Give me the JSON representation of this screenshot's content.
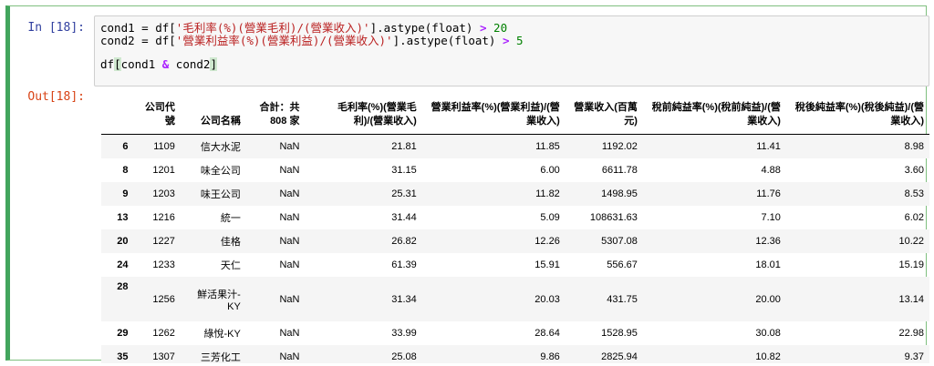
{
  "input": {
    "prompt": "In [18]:",
    "lines": [
      {
        "a": "cond1 = df[",
        "s": "'毛利率(%)(營業毛利)/(營業收入)'",
        "b": "].astype(float) ",
        "op": ">",
        "sp": " ",
        "n": "20"
      },
      {
        "a": "cond2 = df[",
        "s": "'營業利益率(%)(營業利益)/(營業收入)'",
        "b": "].astype(float) ",
        "op": ">",
        "sp": " ",
        "n": "5"
      }
    ],
    "line3": {
      "a": "df",
      "lb": "[",
      "c1": "cond1 ",
      "op": "&",
      "c2": " cond2",
      "rb": "]"
    }
  },
  "output": {
    "prompt": "Out[18]:",
    "columns": [
      "公司代號",
      "公司名稱",
      "合計：共 808 家",
      "毛利率(%)(營業毛利)/(營業收入)",
      "營業利益率(%)(營業利益)/(營業收入)",
      "營業收入(百萬元)",
      "稅前純益率(%)(稅前純益)/(營業收入)",
      "稅後純益率(%)(稅後純益)/(營業收入)"
    ],
    "rows": [
      {
        "idx": "6",
        "code": "1109",
        "name": "信大水泥",
        "total": "NaN",
        "gm": "21.81",
        "om": "11.85",
        "rev": "1192.02",
        "pre": "11.41",
        "post": "8.98"
      },
      {
        "idx": "8",
        "code": "1201",
        "name": "味全公司",
        "total": "NaN",
        "gm": "31.15",
        "om": "6.00",
        "rev": "6611.78",
        "pre": "4.88",
        "post": "3.60"
      },
      {
        "idx": "9",
        "code": "1203",
        "name": "味王公司",
        "total": "NaN",
        "gm": "25.31",
        "om": "11.82",
        "rev": "1498.95",
        "pre": "11.76",
        "post": "8.53"
      },
      {
        "idx": "13",
        "code": "1216",
        "name": "統一",
        "total": "NaN",
        "gm": "31.44",
        "om": "5.09",
        "rev": "108631.63",
        "pre": "7.10",
        "post": "6.02"
      },
      {
        "idx": "20",
        "code": "1227",
        "name": "佳格",
        "total": "NaN",
        "gm": "26.82",
        "om": "12.26",
        "rev": "5307.08",
        "pre": "12.36",
        "post": "10.22"
      },
      {
        "idx": "24",
        "code": "1233",
        "name": "天仁",
        "total": "NaN",
        "gm": "61.39",
        "om": "15.91",
        "rev": "556.67",
        "pre": "18.01",
        "post": "15.19"
      },
      {
        "idx": "28",
        "code": "1256",
        "name": "鮮活果汁-KY",
        "total": "NaN",
        "gm": "31.34",
        "om": "20.03",
        "rev": "431.75",
        "pre": "20.00",
        "post": "13.14"
      },
      {
        "idx": "29",
        "code": "1262",
        "name": "綠悅-KY",
        "total": "NaN",
        "gm": "33.99",
        "om": "28.64",
        "rev": "1528.95",
        "pre": "30.08",
        "post": "22.98"
      },
      {
        "idx": "35",
        "code": "1307",
        "name": "三芳化工",
        "total": "NaN",
        "gm": "25.08",
        "om": "9.86",
        "rev": "2825.94",
        "pre": "10.82",
        "post": "9.37"
      }
    ]
  }
}
